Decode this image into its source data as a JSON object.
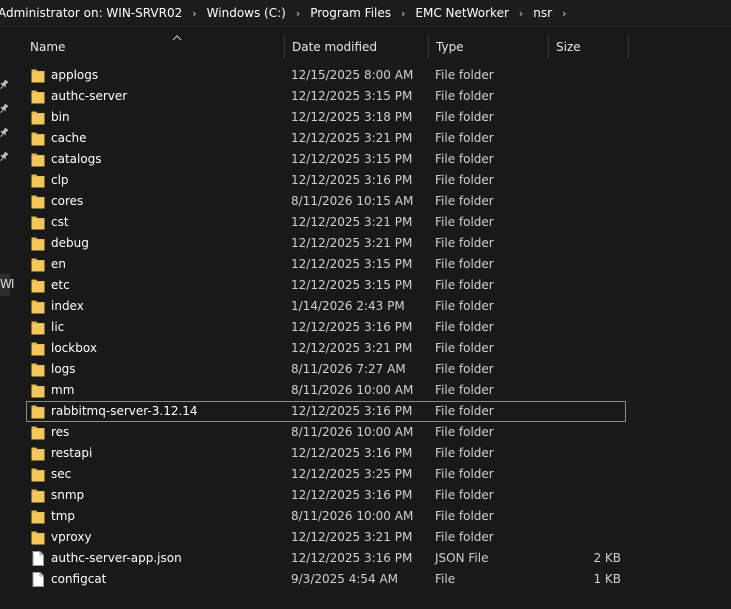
{
  "breadcrumb": [
    "Administrator on: WIN-SRVR02",
    "Windows (C:)",
    "Program Files",
    "EMC NetWorker",
    "nsr"
  ],
  "nav_clipped_text": "WI",
  "columns": {
    "name": "Name",
    "date": "Date modified",
    "type": "Type",
    "size": "Size"
  },
  "icons": {
    "folder": "folder-icon",
    "file": "file-icon",
    "pin": "pin-icon",
    "sort": "sort-up-icon",
    "chevron": "chevron-right-icon"
  },
  "colors": {
    "folder": "#e8b84a",
    "background": "#191919",
    "focus_outline": "#8a8a8a"
  },
  "files": [
    {
      "name": "applogs",
      "date": "12/15/2025 8:00 AM",
      "type": "File folder",
      "size": "",
      "kind": "folder"
    },
    {
      "name": "authc-server",
      "date": "12/12/2025 3:15 PM",
      "type": "File folder",
      "size": "",
      "kind": "folder"
    },
    {
      "name": "bin",
      "date": "12/12/2025 3:18 PM",
      "type": "File folder",
      "size": "",
      "kind": "folder"
    },
    {
      "name": "cache",
      "date": "12/12/2025 3:21 PM",
      "type": "File folder",
      "size": "",
      "kind": "folder"
    },
    {
      "name": "catalogs",
      "date": "12/12/2025 3:15 PM",
      "type": "File folder",
      "size": "",
      "kind": "folder"
    },
    {
      "name": "clp",
      "date": "12/12/2025 3:16 PM",
      "type": "File folder",
      "size": "",
      "kind": "folder"
    },
    {
      "name": "cores",
      "date": "8/11/2026 10:15 AM",
      "type": "File folder",
      "size": "",
      "kind": "folder"
    },
    {
      "name": "cst",
      "date": "12/12/2025 3:21 PM",
      "type": "File folder",
      "size": "",
      "kind": "folder"
    },
    {
      "name": "debug",
      "date": "12/12/2025 3:21 PM",
      "type": "File folder",
      "size": "",
      "kind": "folder"
    },
    {
      "name": "en",
      "date": "12/12/2025 3:15 PM",
      "type": "File folder",
      "size": "",
      "kind": "folder"
    },
    {
      "name": "etc",
      "date": "12/12/2025 3:15 PM",
      "type": "File folder",
      "size": "",
      "kind": "folder"
    },
    {
      "name": "index",
      "date": "1/14/2026 2:43 PM",
      "type": "File folder",
      "size": "",
      "kind": "folder"
    },
    {
      "name": "lic",
      "date": "12/12/2025 3:16 PM",
      "type": "File folder",
      "size": "",
      "kind": "folder"
    },
    {
      "name": "lockbox",
      "date": "12/12/2025 3:21 PM",
      "type": "File folder",
      "size": "",
      "kind": "folder"
    },
    {
      "name": "logs",
      "date": "8/11/2026 7:27 AM",
      "type": "File folder",
      "size": "",
      "kind": "folder"
    },
    {
      "name": "mm",
      "date": "8/11/2026 10:00 AM",
      "type": "File folder",
      "size": "",
      "kind": "folder"
    },
    {
      "name": "rabbitmq-server-3.12.14",
      "date": "12/12/2025 3:16 PM",
      "type": "File folder",
      "size": "",
      "kind": "folder",
      "focused": true
    },
    {
      "name": "res",
      "date": "8/11/2026 10:00 AM",
      "type": "File folder",
      "size": "",
      "kind": "folder"
    },
    {
      "name": "restapi",
      "date": "12/12/2025 3:16 PM",
      "type": "File folder",
      "size": "",
      "kind": "folder"
    },
    {
      "name": "sec",
      "date": "12/12/2025 3:25 PM",
      "type": "File folder",
      "size": "",
      "kind": "folder"
    },
    {
      "name": "snmp",
      "date": "12/12/2025 3:16 PM",
      "type": "File folder",
      "size": "",
      "kind": "folder"
    },
    {
      "name": "tmp",
      "date": "8/11/2026 10:00 AM",
      "type": "File folder",
      "size": "",
      "kind": "folder"
    },
    {
      "name": "vproxy",
      "date": "12/12/2025 3:21 PM",
      "type": "File folder",
      "size": "",
      "kind": "folder"
    },
    {
      "name": "authc-server-app.json",
      "date": "12/12/2025 3:16 PM",
      "type": "JSON File",
      "size": "2 KB",
      "kind": "file"
    },
    {
      "name": "configcat",
      "date": "9/3/2025 4:54 AM",
      "type": "File",
      "size": "1 KB",
      "kind": "file"
    }
  ]
}
